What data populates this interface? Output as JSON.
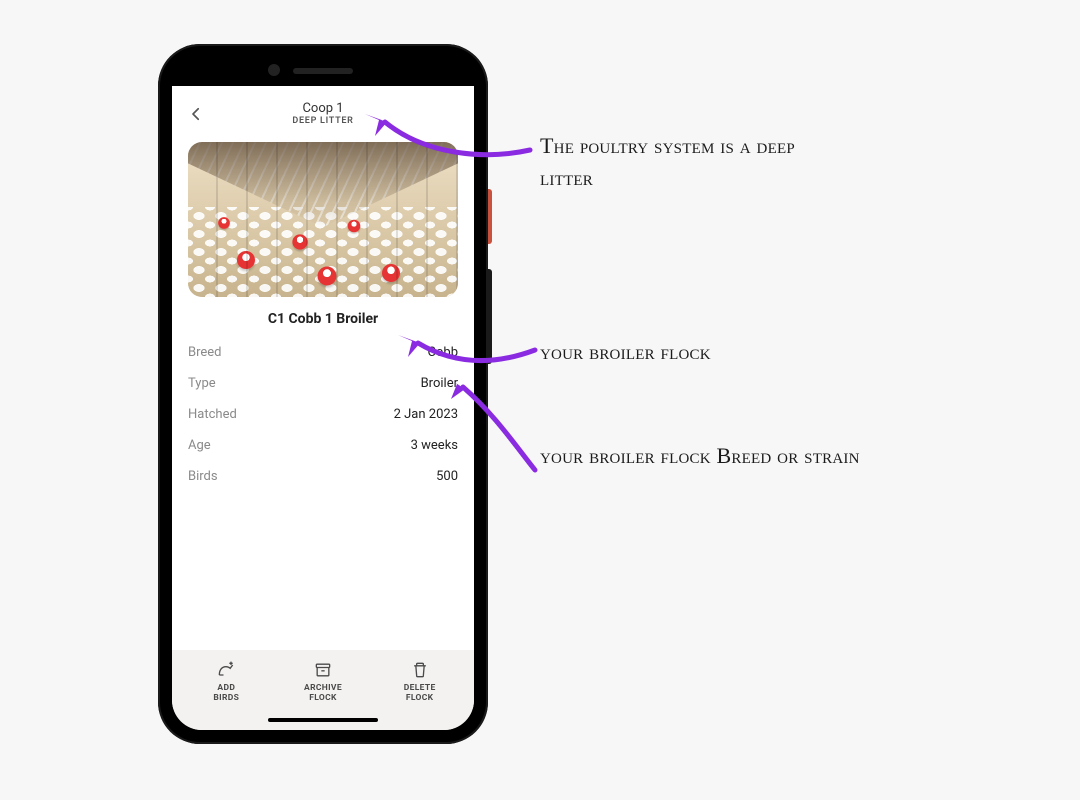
{
  "header": {
    "title": "Coop 1",
    "subtitle": "DEEP LITTER"
  },
  "flock": {
    "name": "C1 Cobb 1 Broiler",
    "image_alt": "poultry-barn-photo"
  },
  "details": [
    {
      "label": "Breed",
      "value": "Cobb"
    },
    {
      "label": "Type",
      "value": "Broiler"
    },
    {
      "label": "Hatched",
      "value": "2 Jan 2023"
    },
    {
      "label": "Age",
      "value": "3 weeks"
    },
    {
      "label": "Birds",
      "value": "500"
    }
  ],
  "actions": {
    "add": {
      "line1": "ADD",
      "line2": "BIRDS"
    },
    "archive": {
      "line1": "ARCHIVE",
      "line2": "FLOCK"
    },
    "delete": {
      "line1": "DELETE",
      "line2": "FLOCK"
    }
  },
  "annotations": {
    "a1": "The poultry system is a deep litter",
    "a2": "your broiler flock",
    "a3": "your broiler flock Breed or strain"
  },
  "colors": {
    "accent": "#8a2be2"
  }
}
